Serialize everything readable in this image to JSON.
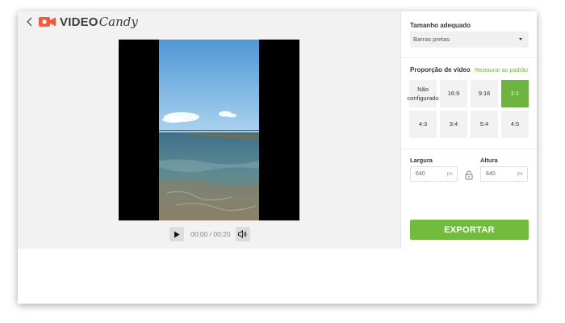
{
  "header": {
    "back_icon": "chevron-left-icon",
    "logo": {
      "icon": "video-camera-icon",
      "word1": "VIDEO",
      "word2": "Candy",
      "brand_color": "#f05a3e"
    }
  },
  "player": {
    "play_icon": "play-icon",
    "time": "00:00 / 00:20",
    "volume_icon": "speaker-icon"
  },
  "settings": {
    "size": {
      "label": "Tamanho adequado",
      "value": "Barras pretas"
    },
    "ratio": {
      "label": "Proporção de vídeo",
      "reset_label": "Restaurar ao padrão",
      "options": [
        {
          "label": "Não\nconfigurado"
        },
        {
          "label": "16:9"
        },
        {
          "label": "9:16"
        },
        {
          "label": "1:1"
        },
        {
          "label": "4:3"
        },
        {
          "label": "3:4"
        },
        {
          "label": "5:4"
        },
        {
          "label": "4:5"
        }
      ],
      "selected": "1:1"
    },
    "dimensions": {
      "width_label": "Largura",
      "width_value": "640",
      "height_label": "Altura",
      "height_value": "640",
      "unit": "px",
      "lock_icon": "lock-icon"
    },
    "export_label": "EXPORTAR"
  },
  "colors": {
    "accent": "#6cb33f",
    "editor_bg": "#f2f2f2"
  }
}
